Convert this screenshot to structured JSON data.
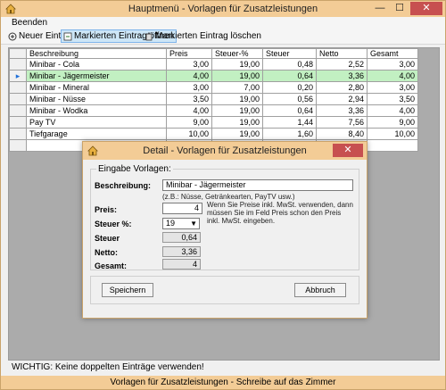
{
  "window": {
    "title": "Hauptmenü - Vorlagen für Zusatzleistungen",
    "minimize": "—",
    "maximize": "☐",
    "close": "✕"
  },
  "menu": {
    "item": "Beenden"
  },
  "toolbar": {
    "new": "Neuer Eintrag",
    "open": "Markierten Eintrag öffnen",
    "delete": "Markierten Eintrag löschen"
  },
  "grid": {
    "columns": [
      "Beschreibung",
      "Preis",
      "Steuer-%",
      "Steuer",
      "Netto",
      "Gesamt"
    ],
    "rows": [
      [
        "Minibar - Cola",
        "3,00",
        "19,00",
        "0,48",
        "2,52",
        "3,00"
      ],
      [
        "Minibar - Jägermeister",
        "4,00",
        "19,00",
        "0,64",
        "3,36",
        "4,00"
      ],
      [
        "Minibar - Mineral",
        "3,00",
        "7,00",
        "0,20",
        "2,80",
        "3,00"
      ],
      [
        "Minibar - Nüsse",
        "3,50",
        "19,00",
        "0,56",
        "2,94",
        "3,50"
      ],
      [
        "Minibar - Wodka",
        "4,00",
        "19,00",
        "0,64",
        "3,36",
        "4,00"
      ],
      [
        "Pay TV",
        "9,00",
        "19,00",
        "1,44",
        "7,56",
        "9,00"
      ],
      [
        "Tiefgarage",
        "10,00",
        "19,00",
        "1,60",
        "8,40",
        "10,00"
      ]
    ],
    "selected_row": 1,
    "selected_marker": "▸"
  },
  "status": "WICHTIG: Keine doppelten Einträge verwenden!",
  "footer": "Vorlagen für Zusatzleistungen - Schreibe auf das Zimmer",
  "dialog": {
    "title": "Detail - Vorlagen für Zusatzleistungen",
    "close": "✕",
    "group_label": "Eingabe Vorlagen:",
    "desc_label": "Beschreibung:",
    "desc_value": "Minibar - Jägermeister",
    "desc_hint": "(z.B.: Nüsse, Getränkearten, PayTV usw.)",
    "price_label": "Preis:",
    "price_value": "4",
    "price_hint": "Wenn Sie Preise inkl. MwSt. verwenden, dann müssen Sie im Feld Preis schon den Preis inkl. MwSt. eingeben.",
    "tax_pct_label": "Steuer %:",
    "tax_pct_value": "19",
    "tax_label": "Steuer",
    "tax_value": "0,64",
    "net_label": "Netto:",
    "net_value": "3,36",
    "total_label": "Gesamt:",
    "total_value": "4",
    "save": "Speichern",
    "cancel": "Abbruch"
  },
  "colors": {
    "titlebar": "#f3cc96",
    "selected_row": "#c2f0c2",
    "close_button": "#c75050"
  }
}
